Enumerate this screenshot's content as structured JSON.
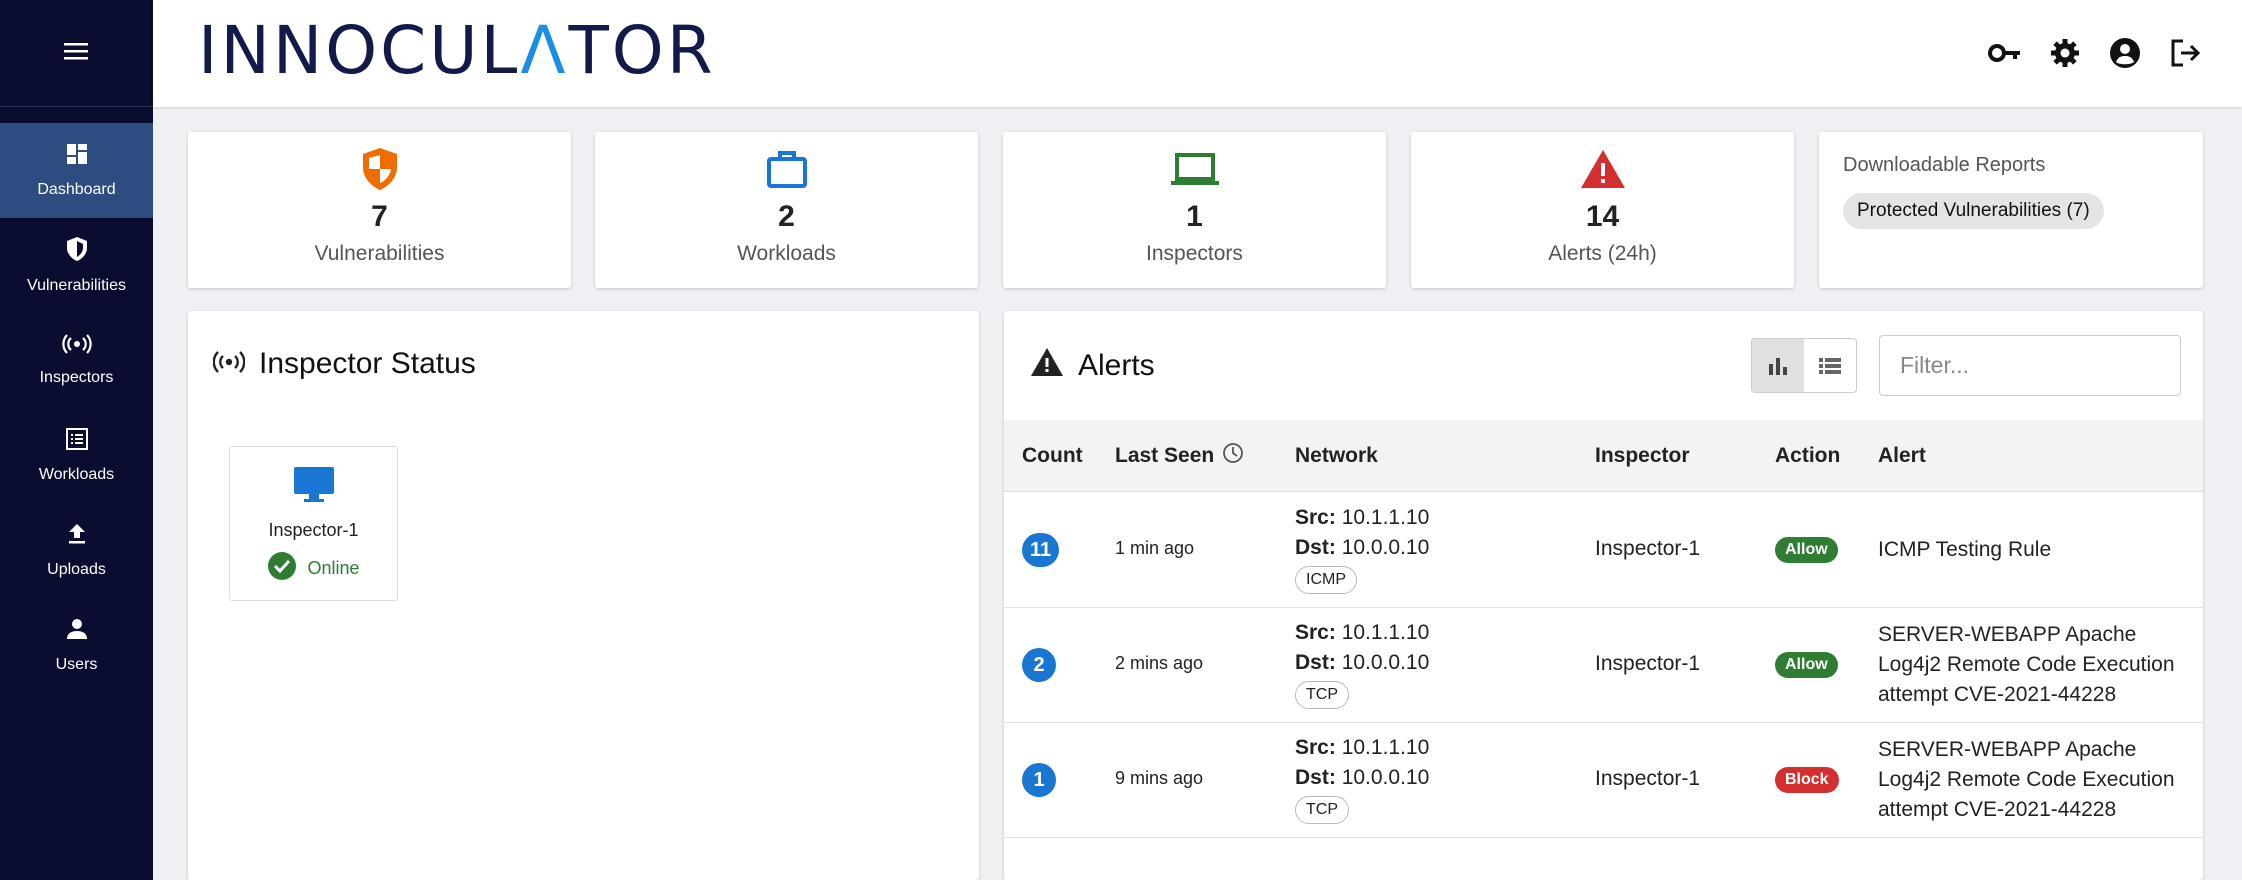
{
  "app": {
    "logo_pre": "INNOCUL",
    "logo_a": "Λ",
    "logo_post": "TOR"
  },
  "sidebar": {
    "items": [
      {
        "label": "Dashboard",
        "icon": "dashboard-icon"
      },
      {
        "label": "Vulnerabilities",
        "icon": "shield-icon"
      },
      {
        "label": "Inspectors",
        "icon": "broadcast-icon"
      },
      {
        "label": "Workloads",
        "icon": "list-icon"
      },
      {
        "label": "Uploads",
        "icon": "upload-icon"
      },
      {
        "label": "Users",
        "icon": "user-icon"
      }
    ]
  },
  "stats": [
    {
      "value": "7",
      "label": "Vulnerabilities",
      "color": "#ef6c00"
    },
    {
      "value": "2",
      "label": "Workloads",
      "color": "#1976d2"
    },
    {
      "value": "1",
      "label": "Inspectors",
      "color": "#2e7d32"
    },
    {
      "value": "14",
      "label": "Alerts (24h)",
      "color": "#d32f2f"
    }
  ],
  "reports": {
    "title": "Downloadable Reports",
    "chip": "Protected Vulnerabilities (7)"
  },
  "inspector_status": {
    "title": "Inspector Status",
    "tiles": [
      {
        "name": "Inspector-1",
        "status": "Online"
      }
    ]
  },
  "alerts": {
    "title": "Alerts",
    "filter_placeholder": "Filter...",
    "columns": [
      "Count",
      "Last Seen",
      "Network",
      "Inspector",
      "Action",
      "Alert"
    ],
    "rows": [
      {
        "count": "11",
        "last_seen": "1 min ago",
        "src_label": "Src:",
        "src": "10.1.1.10",
        "dst_label": "Dst:",
        "dst": "10.0.0.10",
        "proto": "ICMP",
        "inspector": "Inspector-1",
        "action": "Allow",
        "alert": "ICMP Testing Rule"
      },
      {
        "count": "2",
        "last_seen": "2 mins ago",
        "src_label": "Src:",
        "src": "10.1.1.10",
        "dst_label": "Dst:",
        "dst": "10.0.0.10",
        "proto": "TCP",
        "inspector": "Inspector-1",
        "action": "Allow",
        "alert": "SERVER-WEBAPP Apache Log4j2 Remote Code Execution attempt CVE-2021-44228"
      },
      {
        "count": "1",
        "last_seen": "9 mins ago",
        "src_label": "Src:",
        "src": "10.1.1.10",
        "dst_label": "Dst:",
        "dst": "10.0.0.10",
        "proto": "TCP",
        "inspector": "Inspector-1",
        "action": "Block",
        "alert": "SERVER-WEBAPP Apache Log4j2 Remote Code Execution attempt CVE-2021-44228"
      }
    ]
  },
  "colors": {
    "allow": "#2e7d32",
    "block": "#d32f2f",
    "sidebar": "#0a0c30",
    "active": "#2e4c80"
  }
}
